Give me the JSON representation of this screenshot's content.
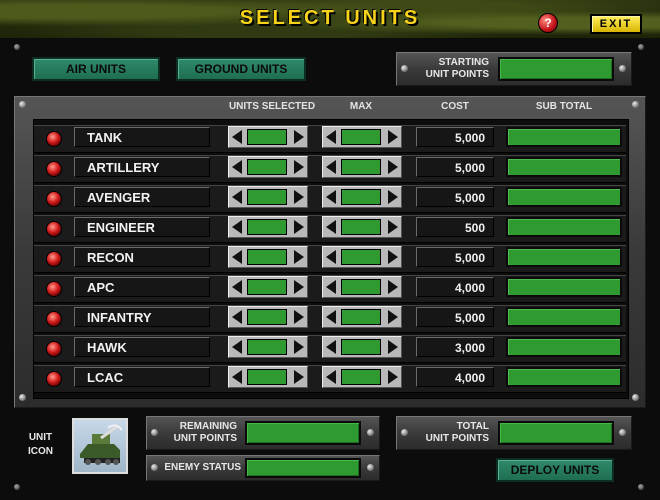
{
  "header": {
    "title": "SELECT UNITS",
    "help_label": "?",
    "exit_label": "EXIT"
  },
  "top": {
    "air_units_label": "AIR UNITS",
    "ground_units_label": "GROUND UNITS",
    "starting_points_label_line1": "STARTING",
    "starting_points_label_line2": "UNIT POINTS",
    "starting_points_value": ""
  },
  "table": {
    "columns": {
      "units_selected": "UNITS SELECTED",
      "max": "MAX",
      "cost": "COST",
      "sub_total": "SUB TOTAL"
    },
    "rows": [
      {
        "name": "TANK",
        "cost": "5,000"
      },
      {
        "name": "ARTILLERY",
        "cost": "5,000"
      },
      {
        "name": "AVENGER",
        "cost": "5,000"
      },
      {
        "name": "ENGINEER",
        "cost": "500"
      },
      {
        "name": "RECON",
        "cost": "5,000"
      },
      {
        "name": "APC",
        "cost": "4,000"
      },
      {
        "name": "INFANTRY",
        "cost": "5,000"
      },
      {
        "name": "HAWK",
        "cost": "3,000"
      },
      {
        "name": "LCAC",
        "cost": "4,000"
      }
    ]
  },
  "bottom": {
    "unit_icon_label_line1": "UNIT",
    "unit_icon_label_line2": "ICON",
    "remaining_label_line1": "REMAINING",
    "remaining_label_line2": "UNIT POINTS",
    "remaining_value": "",
    "enemy_status_label": "ENEMY STATUS",
    "enemy_status_value": "",
    "total_label_line1": "TOTAL",
    "total_label_line2": "UNIT POINTS",
    "total_value": "",
    "deploy_label": "DEPLOY UNITS"
  },
  "icons": [
    "help-icon",
    "led-indicator",
    "arrow-left-icon",
    "arrow-right-icon",
    "vehicle-icon",
    "rivet"
  ]
}
